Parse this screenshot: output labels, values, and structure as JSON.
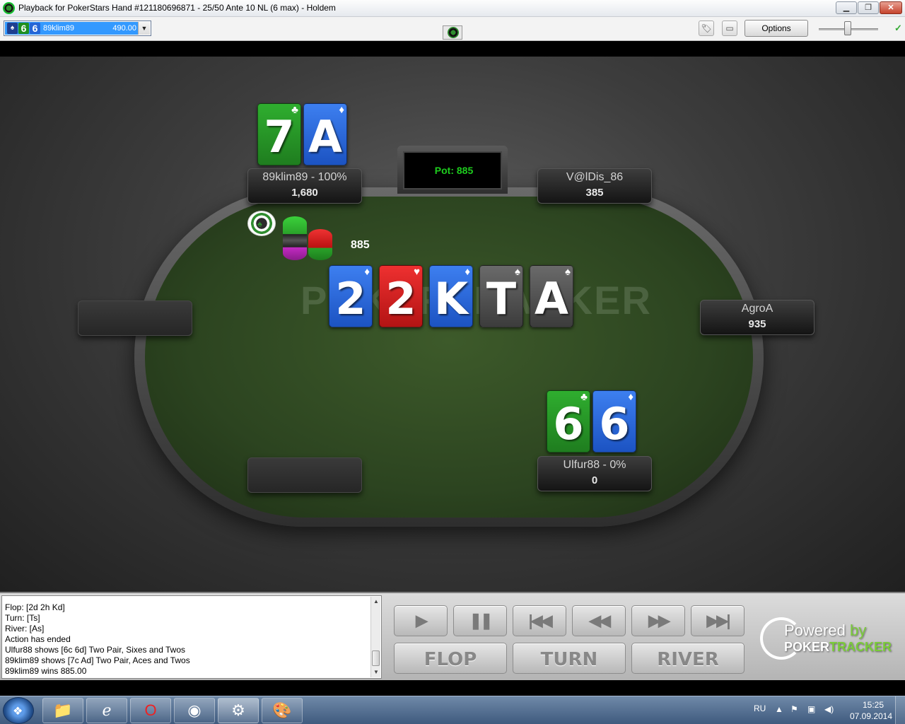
{
  "window": {
    "title": "Playback for PokerStars Hand #121180696871 - 25/50 Ante 10 NL (6 max) - Holdem",
    "minimize_glyph": "▁",
    "maximize_glyph": "❐",
    "close_glyph": "✕"
  },
  "toolbar": {
    "hand_cards": [
      {
        "rank": "6",
        "suit": "club",
        "color": "#1f8f1f"
      },
      {
        "rank": "6",
        "suit": "diamond",
        "color": "#2465d6"
      }
    ],
    "hand_player": "89klim89",
    "hand_amount": "490.00",
    "dropdown_glyph": "▼",
    "tag_icon": "tag-icon",
    "window_icon": "window-icon",
    "options_label": "Options",
    "status_check": "✓"
  },
  "table": {
    "pot_label": "Pot: 885",
    "watermark": "POKERTRACKER",
    "chips_amount": "885",
    "dealer_glyph": "♠",
    "board": [
      {
        "rank": "2",
        "suit": "diamond",
        "suit_glyph": "♦"
      },
      {
        "rank": "2",
        "suit": "heart",
        "suit_glyph": "♥"
      },
      {
        "rank": "K",
        "suit": "diamond",
        "suit_glyph": "♦"
      },
      {
        "rank": "T",
        "suit": "spade",
        "suit_glyph": "♠"
      },
      {
        "rank": "A",
        "suit": "spade",
        "suit_glyph": "♠"
      }
    ],
    "seats": {
      "top_left": {
        "name": "89klim89 - 100%",
        "stack": "1,680",
        "cards": [
          {
            "rank": "7",
            "suit": "club",
            "suit_glyph": "♣"
          },
          {
            "rank": "A",
            "suit": "diamond",
            "suit_glyph": "♦"
          }
        ]
      },
      "top_right": {
        "name": "V@lDis_86",
        "stack": "385"
      },
      "right": {
        "name": "AgroA",
        "stack": "935"
      },
      "bottom_right": {
        "name": "Ulfur88 - 0%",
        "stack": "0",
        "cards": [
          {
            "rank": "6",
            "suit": "club",
            "suit_glyph": "♣"
          },
          {
            "rank": "6",
            "suit": "diamond",
            "suit_glyph": "♦"
          }
        ]
      }
    }
  },
  "log": {
    "lines": [
      "Flop: [2d 2h Kd]",
      "Turn: [Ts]",
      "River: [As]",
      "Action has ended",
      "Ulfur88 shows [6c 6d] Two Pair, Sixes and Twos",
      "89klim89 shows [7c Ad] Two Pair, Aces and Twos",
      "89klim89 wins 885.00"
    ]
  },
  "controls": {
    "play": "▶",
    "pause": "❚❚",
    "first": "|◀◀",
    "prev": "◀◀",
    "next": "▶▶",
    "last": "▶▶|",
    "flop_label": "FLOP",
    "turn_label": "TURN",
    "river_label": "RIVER"
  },
  "branding": {
    "powered": "Powered ",
    "by": "by",
    "poker": "POKER",
    "tracker": "TRACKER"
  },
  "taskbar": {
    "language": "RU",
    "time": "15:25",
    "date": "07.09.2014",
    "items": [
      "folder-icon",
      "ie-icon",
      "opera-icon",
      "chrome-icon",
      "pokertracker-icon",
      "paint-icon"
    ]
  },
  "colors": {
    "club": "#2a9e2a",
    "diamond": "#2a6ee0",
    "heart": "#d41f1f",
    "spade": "#555555",
    "pot_text": "#1ecd1e",
    "brand_green": "#7acb3a"
  }
}
